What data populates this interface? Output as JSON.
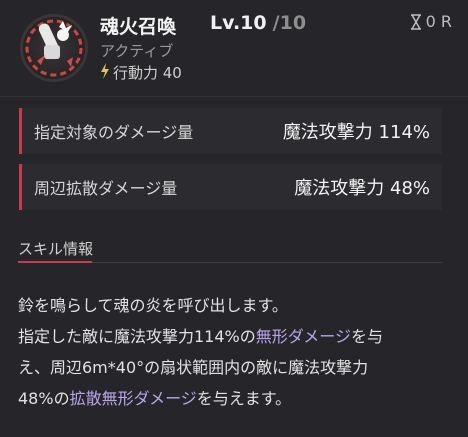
{
  "skill": {
    "name": "魂火召喚",
    "level_label": "Lv.10",
    "level_max": "/10",
    "cooldown": "0 R",
    "type": "アクティブ",
    "action_power": "行動力 40"
  },
  "stats": [
    {
      "label": "指定対象のダメージ量",
      "value": "魔法攻撃力 114%"
    },
    {
      "label": "周辺拡散ダメージ量",
      "value": "魔法攻撃力 48%"
    }
  ],
  "section": {
    "title": "スキル情報"
  },
  "description": {
    "line1": "鈴を鳴らして魂の炎を呼び出します。",
    "line2_a": "指定した敵に魔法攻撃力114%の",
    "line2_hl": "無形ダメージ",
    "line2_b": "を与",
    "line3": "え、周辺6m*40°の扇状範囲内の敵に魔法攻撃力",
    "line4_a": "48%の",
    "line4_hl": "拡散無形ダメージ",
    "line4_b": "を与えます。"
  },
  "colors": {
    "accent": "#c93a4e",
    "highlight": "#b9a6e8",
    "background": "#26262a"
  },
  "icons": {
    "skill": "bell-skill-icon",
    "cooldown": "hourglass-icon",
    "action": "lightning-icon"
  }
}
